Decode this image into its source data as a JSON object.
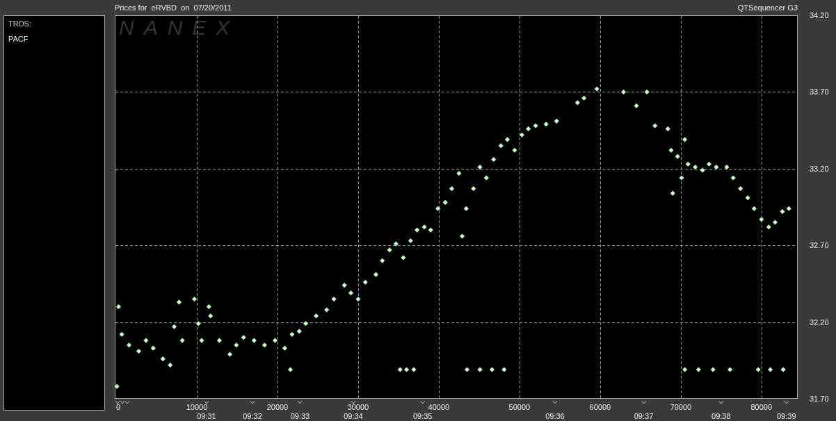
{
  "header": {
    "title": "Prices for  eRVBD  on  07/20/2011",
    "app_name": "QTSequencer G3"
  },
  "legend": {
    "heading": "TRDS:"
  },
  "chart": {
    "logo": "NANEX",
    "chart_data": {
      "type": "scatter",
      "grid": true,
      "xlim": [
        0,
        84500
      ],
      "ylim": [
        31.7,
        34.2
      ],
      "annotations": [
        "09:31",
        "09:32",
        "09:33",
        "09:34",
        "09:35",
        "09:36",
        "09:37",
        "09:38",
        "09:39"
      ],
      "xticks": [
        0,
        10000,
        20000,
        30000,
        40000,
        50000,
        60000,
        70000,
        80000
      ],
      "yticks": [
        {
          "value": 31.7,
          "label": "31.70"
        },
        {
          "value": 32.2,
          "label": "32.20"
        },
        {
          "value": 32.7,
          "label": "32.70"
        },
        {
          "value": 33.2,
          "label": "33.20"
        },
        {
          "value": 33.7,
          "label": "33.70"
        },
        {
          "value": 34.2,
          "label": "34.20"
        }
      ],
      "x": [
        100,
        300,
        700,
        1600,
        2800,
        3700,
        4600,
        5800,
        6700,
        7200,
        7800,
        8200,
        9700,
        10200,
        10600,
        11500,
        11700,
        12800,
        14100,
        14900,
        15800,
        17100,
        18400,
        19700,
        20900,
        21800,
        22700,
        23500,
        24800,
        26100,
        27000,
        28300,
        29100,
        30000,
        30900,
        32200,
        33000,
        33900,
        34700,
        35600,
        36500,
        37300,
        38200,
        39000,
        39900,
        40800,
        41600,
        42500,
        42900,
        43400,
        44300,
        45100,
        45900,
        46800,
        47700,
        48500,
        49400,
        50300,
        51100,
        52000,
        53300,
        54600,
        57200,
        58000,
        59600,
        62900,
        64500,
        65800,
        66800,
        68400,
        68800,
        69000,
        69600,
        70100,
        70500,
        70900,
        71800,
        72700,
        73500,
        74400,
        75700,
        76500,
        77400,
        78300,
        79100,
        80000,
        80900,
        81700,
        82600,
        83400,
        21600,
        35200,
        36000,
        36900,
        43500,
        45100,
        46600,
        48100,
        70500,
        72200,
        74000,
        76100,
        79600,
        81100,
        82700
      ],
      "series": [
        {
          "name": "PACF",
          "color": "#ccffcc",
          "values": [
            31.78,
            32.3,
            32.12,
            32.05,
            32.01,
            32.08,
            32.03,
            31.96,
            31.92,
            32.17,
            32.33,
            32.08,
            32.35,
            32.19,
            32.08,
            32.3,
            32.24,
            32.08,
            31.99,
            32.05,
            32.1,
            32.08,
            32.05,
            32.08,
            32.03,
            32.12,
            32.14,
            32.19,
            32.24,
            32.28,
            32.35,
            32.44,
            32.39,
            32.35,
            32.46,
            32.51,
            32.6,
            32.67,
            32.71,
            32.62,
            32.73,
            32.8,
            32.82,
            32.8,
            32.94,
            32.98,
            33.07,
            33.17,
            32.76,
            32.94,
            33.07,
            33.21,
            33.14,
            33.26,
            33.35,
            33.39,
            33.32,
            33.42,
            33.46,
            33.48,
            33.49,
            33.51,
            33.63,
            33.66,
            33.72,
            33.7,
            33.61,
            33.7,
            33.48,
            33.46,
            33.32,
            33.04,
            33.28,
            33.14,
            33.39,
            33.23,
            33.21,
            33.19,
            33.23,
            33.21,
            33.21,
            33.14,
            33.07,
            33.01,
            32.94,
            32.87,
            32.82,
            32.85,
            32.92,
            32.94,
            31.89,
            31.89,
            31.89,
            31.89,
            31.89,
            31.89,
            31.89,
            31.89,
            31.89,
            31.89,
            31.89,
            31.89,
            31.89,
            31.89,
            31.89
          ]
        }
      ]
    }
  }
}
